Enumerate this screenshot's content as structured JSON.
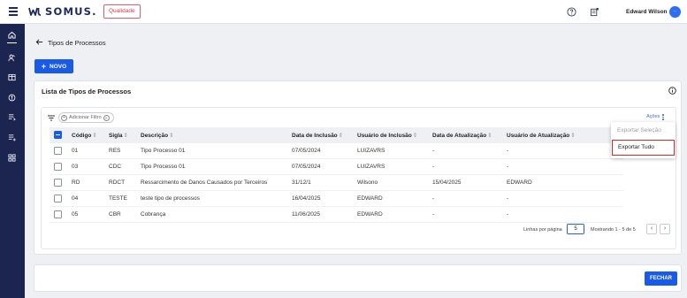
{
  "app": {
    "brand": "SOMUS.",
    "module_badge": "Qualidade",
    "user_name": "Edward Wilson",
    "avatar_initial": "··"
  },
  "page": {
    "title": "Tipos de Processos",
    "new_button": "NOVO",
    "close_button": "FECHAR"
  },
  "list": {
    "title": "Lista de Tipos de Processos",
    "filter_label": "Adicionar Filtro",
    "actions_label": "Ações",
    "columns": [
      "Código",
      "Sigla",
      "Descrição",
      "Data de Inclusão",
      "Usuário de Inclusão",
      "Data de Atualização",
      "Usuário de Atualização"
    ],
    "rows": [
      [
        "01",
        "RES",
        "Tipo Processo 01",
        "07/05/2024",
        "LUIZAVRS",
        "-",
        "-"
      ],
      [
        "03",
        "CDC",
        "Tipo Processo 01",
        "07/05/2024",
        "LUIZAVRS",
        "-",
        "-"
      ],
      [
        "RD",
        "RDCT",
        "Ressarcimento de Danos Causados por Terceiros",
        "31/12/1",
        "Wilsono",
        "15/04/2025",
        "EDWARD"
      ],
      [
        "04",
        "TESTE",
        "teste tipo de processos",
        "16/04/2025",
        "EDWARD",
        "-",
        "-"
      ],
      [
        "05",
        "CBR",
        "Cobrança",
        "11/06/2025",
        "EDWARD",
        "-",
        "-"
      ]
    ]
  },
  "actions_menu": {
    "export_selection": "Exportar Seleção",
    "export_all": "Exportar Tudo"
  },
  "pagination": {
    "rows_per_page_label": "Linhas por página",
    "rows_per_page": "5",
    "range_text": "Mostrando 1 - 5 de 5",
    "prev": "‹",
    "next": "›"
  },
  "colors": {
    "primary": "#1a5ae8",
    "sidebar": "#1b2550",
    "highlight_border": "#d42a2a",
    "badge": "#d93a4f"
  },
  "icons": {
    "menu": "hamburger-icon",
    "help": "help-icon",
    "news": "news-icon",
    "back": "arrow-left-icon",
    "info": "info-icon",
    "filter": "filter-icon"
  }
}
